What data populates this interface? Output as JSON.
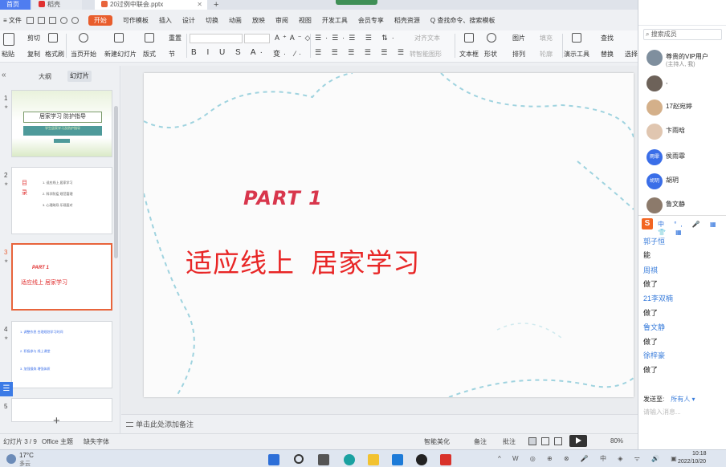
{
  "tabs": {
    "home": "首页",
    "wps": "稻壳",
    "doc": "20过例中联会.pptx",
    "add": "+"
  },
  "menu": {
    "file": "≡ 文件",
    "start": "开始",
    "items": [
      "可作模板",
      "插入",
      "设计",
      "切换",
      "动画",
      "放映",
      "审阅",
      "视图",
      "开发工具",
      "会员专享",
      "稻壳资源"
    ],
    "search": "Q 查找命令、搜索模板"
  },
  "ribbon": {
    "paste": "粘贴",
    "cut": "剪切",
    "copy": "复制",
    "format_painter": "格式刷",
    "from_current": "当页开始",
    "new_slide": "新建幻灯片",
    "layout": "版式",
    "section": "节",
    "reset": "重置",
    "text_box": "文本框",
    "shape": "形状",
    "arrange": "排列",
    "picture": "图片",
    "fill": "填充",
    "outline": "轮廓",
    "present_tools": "演示工具",
    "find": "查找",
    "replace": "替换",
    "select": "选择",
    "align_text": "对齐文本",
    "smart_convert": "转智能图形"
  },
  "left_panel": {
    "collapse": "«",
    "tab_outline": "大纲",
    "tab_slides": "幻灯片",
    "add": "+",
    "side_button": "☰",
    "thumbs": [
      {
        "num": "1",
        "title": "居家学习 防护指导",
        "sub": "学生居家学习及防护指导"
      },
      {
        "num": "2",
        "mu": "目录",
        "lines": [
          "1. 适应线上 居家学习",
          "2. 科学防疫 规范管理",
          "3. 心理疏导 乐观面对"
        ]
      },
      {
        "num": "3",
        "part": "PART 1",
        "title": "适应线上 居家学习"
      },
      {
        "num": "4",
        "lines": [
          "1. 调整作息 合理规划学习时间",
          "2. 积极参与 线上课堂",
          "3. 加强锻炼 增强体质"
        ]
      }
    ]
  },
  "slide": {
    "part": "PART 1",
    "title": "适应线上  居家学习"
  },
  "notes": {
    "placeholder": "单击此处添加备注"
  },
  "status": {
    "slide_count": "幻灯片 3 / 9",
    "theme": "Office 主题",
    "missing_font": "缺失字体",
    "beautify": "智能美化",
    "notes": "备注",
    "comments": "批注",
    "zoom": "80%"
  },
  "taskbar": {
    "temp": "17°C",
    "weather": "多云",
    "time": "10:18",
    "date": "2022/10/20"
  },
  "chat": {
    "search_placeholder": "搜索成员",
    "members": [
      {
        "name": "尊贵的VIP用户",
        "sub": "(主持人, 我)"
      },
      {
        "name": ","
      },
      {
        "name": "17赵宛婷"
      },
      {
        "name": "卞雨晗"
      },
      {
        "name": "侯雨霏",
        "avatar": "雨霏"
      },
      {
        "name": "胡玥",
        "avatar": "胡玥"
      },
      {
        "name": "鲁文静"
      }
    ],
    "ime_label": "S",
    "ime_tools": "中 °, 🎤 ▦ 👕 ▦",
    "messages": [
      {
        "name": "郭子恒",
        "text": "能"
      },
      {
        "name": "周祺",
        "text": "做了"
      },
      {
        "name": "21李双楠",
        "text": "做了"
      },
      {
        "name": "鲁文静",
        "text": "做了"
      },
      {
        "name": "徐梓豪",
        "text": "做了"
      }
    ],
    "send_to_label": "发送至:",
    "send_to_value": "所有人 ▾",
    "input_placeholder": "请输入消息..."
  },
  "colors": {
    "accent": "#e85d2c",
    "title_red": "#e82626",
    "part_red": "#d8364c",
    "doodle": "#9fd3df"
  }
}
